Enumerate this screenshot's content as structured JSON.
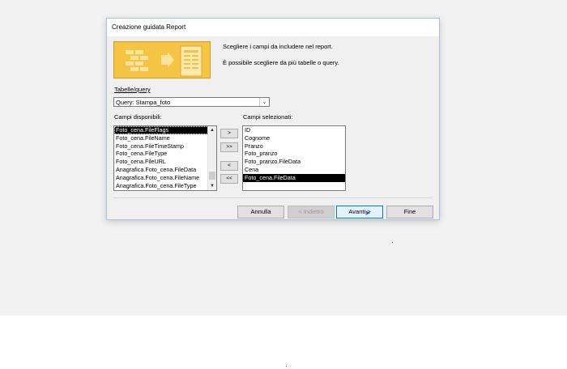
{
  "dialog": {
    "title": "Creazione guidata Report",
    "instruction_1": "Scegliere i campi da includere nel report.",
    "instruction_2": "È possibile scegliere da più tabelle o query."
  },
  "source": {
    "label": "Tabelle/query",
    "selected": "Query: Stampa_foto"
  },
  "available": {
    "label": "Campi disponibili:",
    "items": [
      "Foto_cena.FileFlags",
      "Foto_cena.FileName",
      "Foto_cena.FileTimeStamp",
      "Foto_cena.FileType",
      "Foto_cena.FileURL",
      "Anagrafica.Foto_cena.FileData",
      "Anagrafica.Foto_cena.FileName",
      "Anagrafica.Foto_cena.FileType"
    ]
  },
  "selected_fields": {
    "label": "Campi selezionati:",
    "items": [
      "ID",
      "Cognome",
      "Pranzo",
      "Foto_pranzo",
      "Foto_pranzo.FileData",
      "Cena",
      "Foto_cena.FileData"
    ]
  },
  "move": {
    "add_one": ">",
    "add_all": ">>",
    "remove_one": "<",
    "remove_all": "<<"
  },
  "buttons": {
    "cancel": "Annulla",
    "back": "< Indietro",
    "next": "Avanti >",
    "finish": "Fine"
  }
}
